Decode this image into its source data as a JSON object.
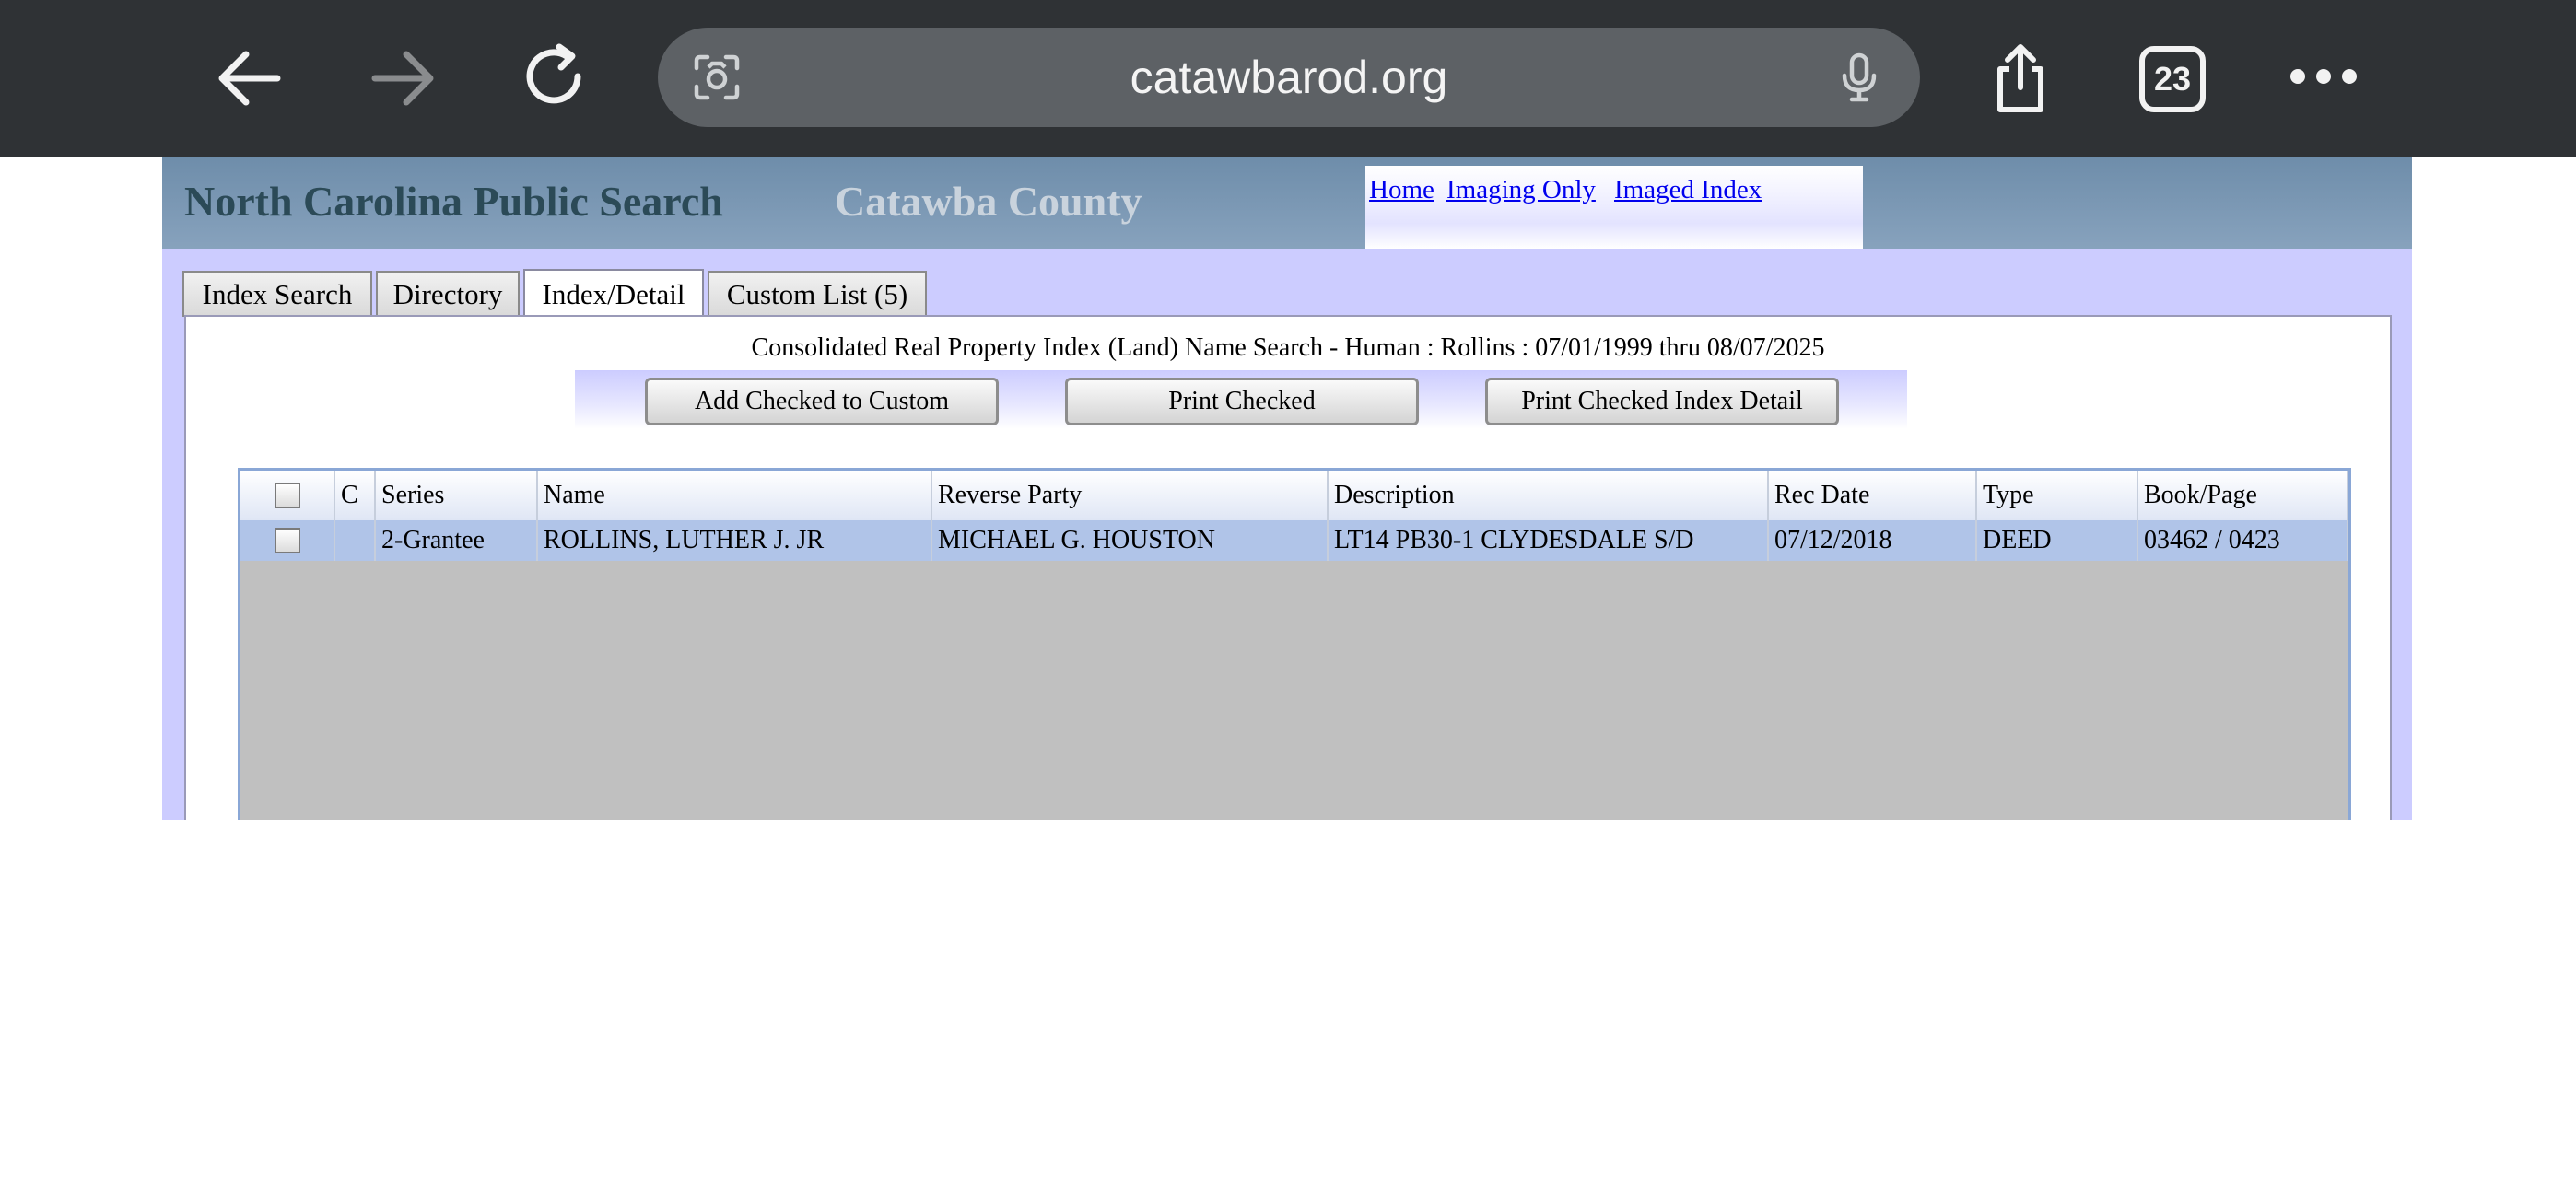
{
  "browser": {
    "url": "catawbarod.org",
    "tab_count": "23"
  },
  "site": {
    "title": "North Carolina Public Search",
    "county": "Catawba County",
    "links": [
      "Home",
      "Imaging Only",
      "Imaged Index"
    ]
  },
  "tabs": [
    {
      "label": "Index Search",
      "active": false
    },
    {
      "label": "Directory",
      "active": false
    },
    {
      "label": "Index/Detail",
      "active": true
    },
    {
      "label": "Custom List (5)",
      "active": false
    }
  ],
  "results": {
    "heading": "Consolidated Real Property Index (Land) Name Search - Human : Rollins : 07/01/1999 thru 08/07/2025",
    "buttons": {
      "add_checked": "Add Checked to Custom",
      "print_checked": "Print Checked",
      "print_detail": "Print Checked Index Detail"
    },
    "columns": [
      "C",
      "Series",
      "Name",
      "Reverse Party",
      "Description",
      "Rec Date",
      "Type",
      "Book/Page"
    ],
    "rows": [
      {
        "c": "",
        "series": "2-Grantee",
        "name": "ROLLINS, LUTHER J. JR",
        "reverse_party": "MICHAEL G. HOUSTON",
        "description": "LT14 PB30-1 CLYDESDALE S/D",
        "rec_date": "07/12/2018",
        "type": "DEED",
        "book_page": "03462 / 0423"
      }
    ]
  }
}
